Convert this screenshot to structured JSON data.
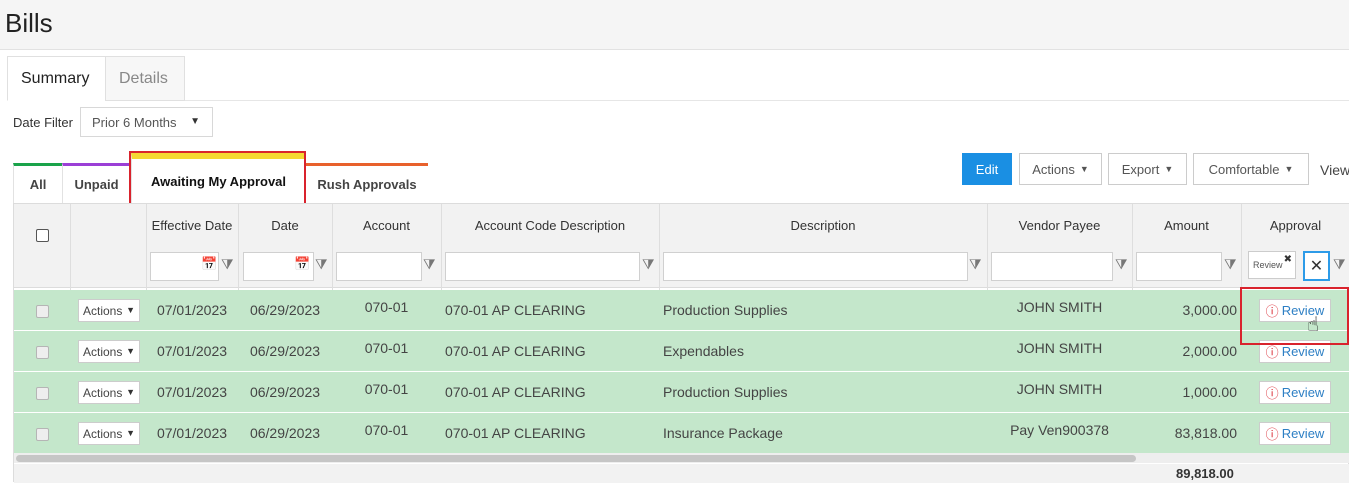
{
  "page": {
    "title": "Bills"
  },
  "main_tabs": [
    "Summary",
    "Details"
  ],
  "date_filter": {
    "label": "Date Filter",
    "value": "Prior 6 Months"
  },
  "sub_tabs": [
    {
      "label": "All",
      "color": "#1aa34a"
    },
    {
      "label": "Unpaid",
      "color": "#9b3fd6"
    },
    {
      "label": "Awaiting My Approval",
      "color": "#f5d733"
    },
    {
      "label": "Rush Approvals",
      "color": "#e8612c"
    }
  ],
  "toolbar": {
    "edit": "Edit",
    "actions": "Actions",
    "export": "Export",
    "density": "Comfortable",
    "view": "View"
  },
  "grid": {
    "columns": [
      "Effective Date",
      "Date",
      "Account",
      "Account Code Description",
      "Description",
      "Vendor Payee",
      "Amount",
      "Approval"
    ],
    "approval_filter_chip": "Review",
    "rows": [
      {
        "actions": "Actions",
        "effective_date": "07/01/2023",
        "date": "06/29/2023",
        "account": "070-01",
        "account_desc": "070-01 AP CLEARING",
        "description": "Production Supplies",
        "vendor": "JOHN SMITH",
        "amount": "3,000.00",
        "approval": "Review"
      },
      {
        "actions": "Actions",
        "effective_date": "07/01/2023",
        "date": "06/29/2023",
        "account": "070-01",
        "account_desc": "070-01 AP CLEARING",
        "description": "Expendables",
        "vendor": "JOHN SMITH",
        "amount": "2,000.00",
        "approval": "Review"
      },
      {
        "actions": "Actions",
        "effective_date": "07/01/2023",
        "date": "06/29/2023",
        "account": "070-01",
        "account_desc": "070-01 AP CLEARING",
        "description": "Production Supplies",
        "vendor": "JOHN SMITH",
        "amount": "1,000.00",
        "approval": "Review"
      },
      {
        "actions": "Actions",
        "effective_date": "07/01/2023",
        "date": "06/29/2023",
        "account": "070-01",
        "account_desc": "070-01 AP CLEARING",
        "description": "Insurance Package",
        "vendor": "Pay Ven900378",
        "amount": "83,818.00",
        "approval": "Review"
      }
    ],
    "total": "89,818.00"
  },
  "colors": {
    "row_bg": "#c4e7cb",
    "primary": "#1a8fe3",
    "highlight": "#d9232d"
  },
  "icons": [
    "calendar-icon",
    "filter-icon",
    "close-icon",
    "warning-icon",
    "hand-cursor-icon"
  ]
}
